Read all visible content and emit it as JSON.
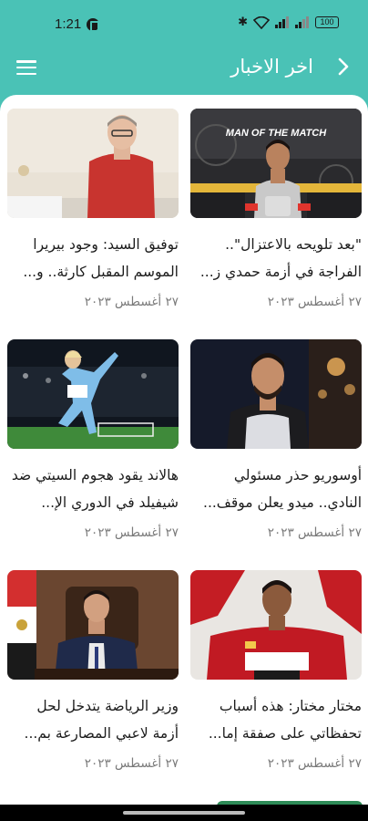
{
  "status_bar": {
    "time": "1:21",
    "battery": "100"
  },
  "header": {
    "title": "اخر الاخبار"
  },
  "articles": [
    {
      "title": "\"بعد تلويحه بالاعتزال\".. الفراجة في أزمة حمدي ز...",
      "date": "٢٧ أغسطس ٢٠٢٣",
      "banner_text": "MAN OF THE MATCH"
    },
    {
      "title": "توفيق السيد: وجود بيريرا الموسم المقبل كارثة.. و...",
      "date": "٢٧ أغسطس ٢٠٢٣"
    },
    {
      "title": "أوسوريو حذر مسئولي النادي.. ميدو يعلن موقف...",
      "date": "٢٧ أغسطس ٢٠٢٣"
    },
    {
      "title": "هالاند يقود هجوم السيتي ضد شيفيلد في الدوري الإ...",
      "date": "٢٧ أغسطس ٢٠٢٣"
    },
    {
      "title": "مختار مختار: هذه أسباب تحفظاتي على صفقة إما...",
      "date": "٢٧ أغسطس ٢٠٢٣"
    },
    {
      "title": "وزير الرياضة يتدخل لحل أزمة لاعبي المصارعة بم...",
      "date": "٢٧ أغسطس ٢٠٢٣"
    }
  ]
}
